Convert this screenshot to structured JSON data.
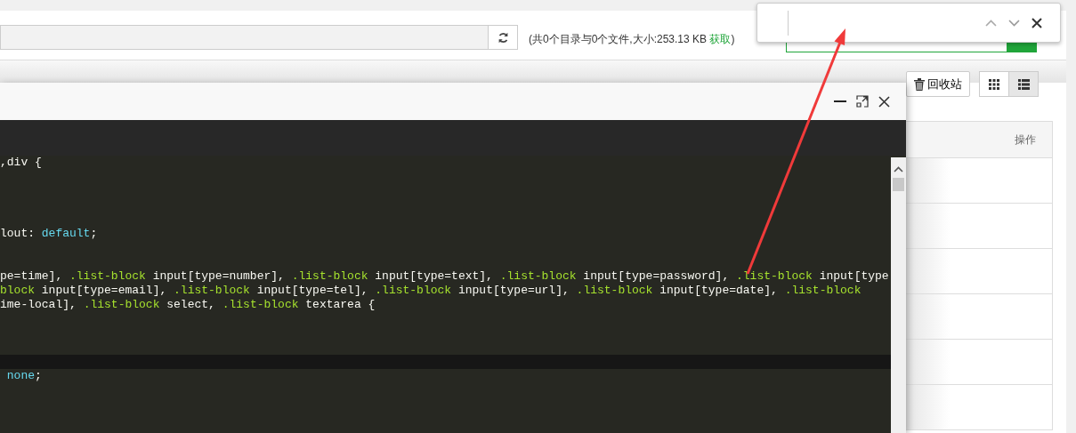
{
  "path_bar": {
    "summary_before": "(共0个目录与0个文件,大小:253.13 KB ",
    "summary_link": "获取",
    "summary_after": ")"
  },
  "toolbar": {
    "recycle_button": "回收站",
    "views": [
      {
        "kind": "grid",
        "selected": false
      },
      {
        "kind": "list",
        "selected": true
      }
    ]
  },
  "table": {
    "columns": [
      "操作"
    ]
  },
  "editor": {
    "lines": [
      {
        "kind": "code",
        "tokens": [
          {
            "kind": "plain",
            "text": ",div {"
          }
        ]
      },
      {
        "kind": "code"
      },
      {
        "kind": "code"
      },
      {
        "kind": "code"
      },
      {
        "kind": "code"
      },
      {
        "kind": "code",
        "tokens": [
          {
            "kind": "plain",
            "text": "lout: "
          },
          {
            "kind": "value",
            "text": "default"
          },
          {
            "kind": "plain",
            "text": ";"
          }
        ]
      },
      {
        "kind": "code"
      },
      {
        "kind": "code"
      },
      {
        "kind": "code",
        "tokens": [
          {
            "kind": "plain",
            "text": "pe=time], "
          },
          {
            "kind": "class",
            "text": ".list-block"
          },
          {
            "kind": "plain",
            "text": " input[type=number], "
          },
          {
            "kind": "class",
            "text": ".list-block"
          },
          {
            "kind": "plain",
            "text": " input[type=text], "
          },
          {
            "kind": "class",
            "text": ".list-block"
          },
          {
            "kind": "plain",
            "text": " input[type=password], "
          },
          {
            "kind": "class",
            "text": ".list-block"
          },
          {
            "kind": "plain",
            "text": " input[type"
          }
        ]
      },
      {
        "kind": "code",
        "tokens": [
          {
            "kind": "class",
            "text": "block"
          },
          {
            "kind": "plain",
            "text": " input[type=email], "
          },
          {
            "kind": "class",
            "text": ".list-block"
          },
          {
            "kind": "plain",
            "text": " input[type=tel], "
          },
          {
            "kind": "class",
            "text": ".list-block"
          },
          {
            "kind": "plain",
            "text": " input[type=url], "
          },
          {
            "kind": "class",
            "text": ".list-block"
          },
          {
            "kind": "plain",
            "text": " input[type=date], "
          },
          {
            "kind": "class",
            "text": ".list-block"
          }
        ]
      },
      {
        "kind": "code",
        "tokens": [
          {
            "kind": "plain",
            "text": "ime-local], "
          },
          {
            "kind": "class",
            "text": ".list-block"
          },
          {
            "kind": "plain",
            "text": " select, "
          },
          {
            "kind": "class",
            "text": ".list-block"
          },
          {
            "kind": "plain",
            "text": " textarea {"
          }
        ]
      },
      {
        "kind": "code"
      },
      {
        "kind": "code"
      },
      {
        "kind": "code"
      },
      {
        "kind": "current"
      },
      {
        "kind": "code",
        "tokens": [
          {
            "kind": "value",
            "text": " none"
          },
          {
            "kind": "plain",
            "text": ";"
          }
        ]
      },
      {
        "kind": "code"
      },
      {
        "kind": "code"
      },
      {
        "kind": "code"
      }
    ]
  }
}
